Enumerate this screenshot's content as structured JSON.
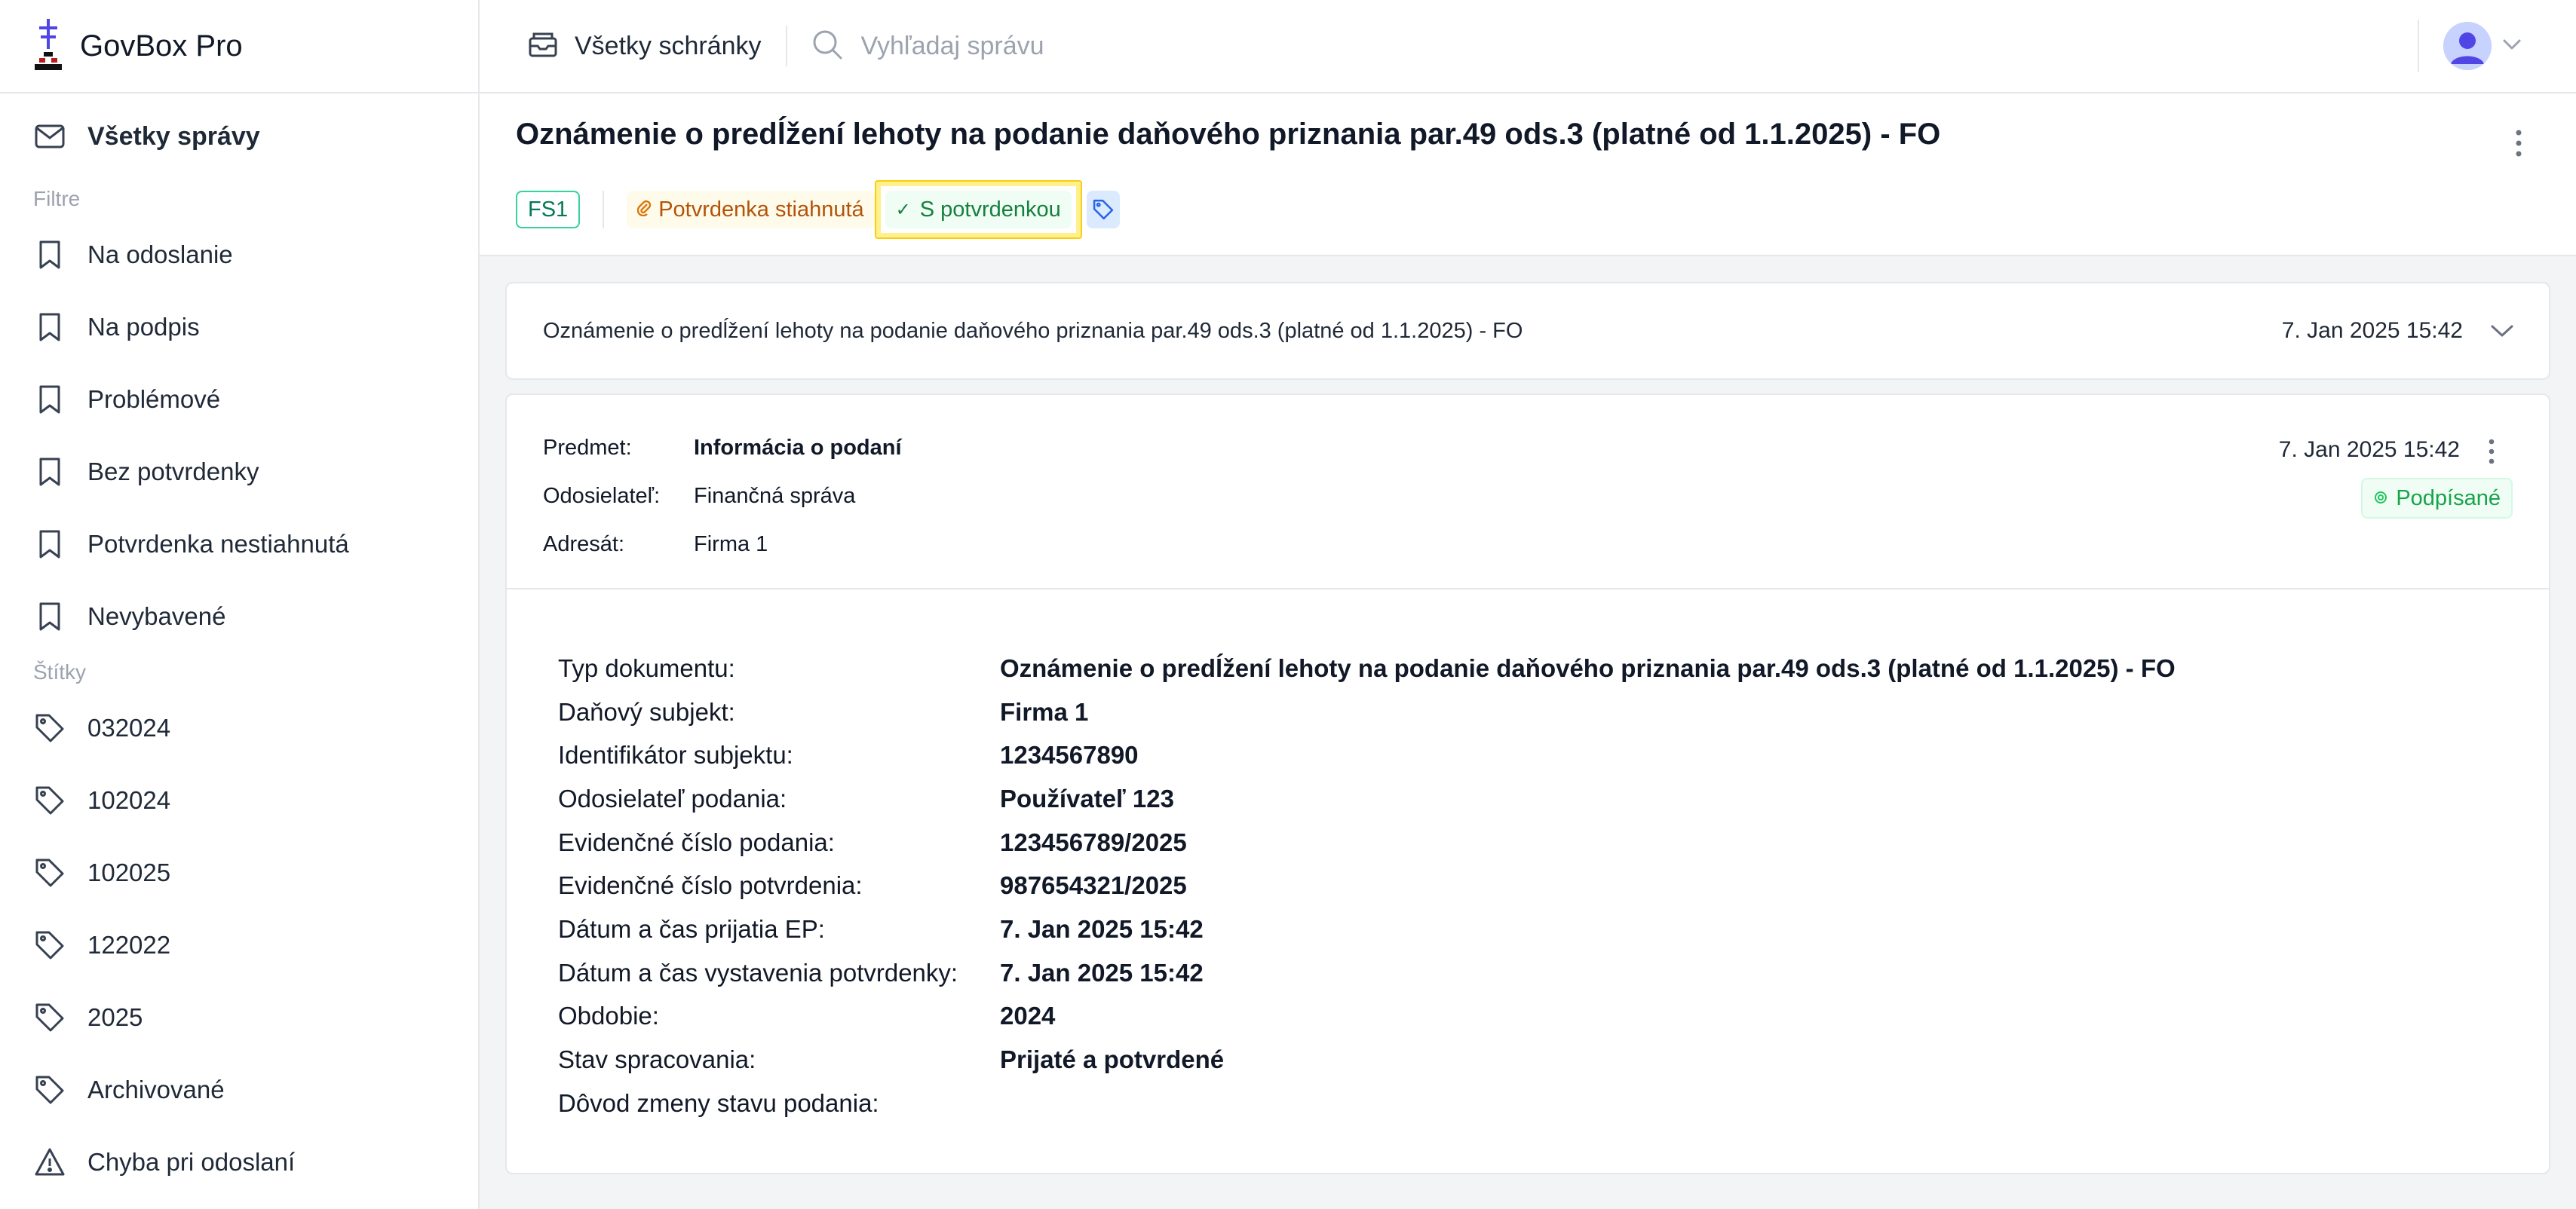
{
  "brand": {
    "name": "GovBox Pro"
  },
  "sidebar": {
    "all_messages": "Všetky správy",
    "filters_title": "Filtre",
    "filters": [
      {
        "label": "Na odoslanie"
      },
      {
        "label": "Na podpis"
      },
      {
        "label": "Problémové"
      },
      {
        "label": "Bez potvrdenky"
      },
      {
        "label": "Potvrdenka nestiahnutá"
      },
      {
        "label": "Nevybavené"
      }
    ],
    "tags_title": "Štítky",
    "tags": [
      {
        "label": "032024"
      },
      {
        "label": "102024"
      },
      {
        "label": "102025"
      },
      {
        "label": "122022"
      },
      {
        "label": "2025"
      },
      {
        "label": "Archivované"
      }
    ],
    "error_item": "Chyba pri odoslaní"
  },
  "topbar": {
    "mailboxes_label": "Všetky schránky",
    "search_placeholder": "Vyhľadaj správu"
  },
  "message": {
    "title": "Oznámenie o predĺžení lehoty na podanie daňového priznania par.49 ods.3 (platné od 1.1.2025) - FO",
    "tags": {
      "box": "FS1",
      "downloaded": "Potvrdenka stiahnutá",
      "with_receipt": "S potvrdenkou"
    }
  },
  "thread_item": {
    "subject": "Oznámenie o predĺžení lehoty na podanie daňového priznania par.49 ods.3 (platné od 1.1.2025) - FO",
    "date": "7. Jan 2025 15:42"
  },
  "detail": {
    "labels": {
      "subject": "Predmet:",
      "sender": "Odosielateľ:",
      "recipient": "Adresát:"
    },
    "subject": "Informácia o podaní",
    "sender": "Finančná správa",
    "recipient": "Firma 1",
    "date": "7. Jan 2025 15:42",
    "signed_badge": "Podpísané",
    "fields": [
      {
        "k": "Typ dokumentu:",
        "v": "Oznámenie o predĺžení lehoty na podanie daňového priznania par.49 ods.3 (platné od 1.1.2025) - FO"
      },
      {
        "k": "Daňový subjekt:",
        "v": "Firma 1"
      },
      {
        "k": "Identifikátor subjektu:",
        "v": "1234567890"
      },
      {
        "k": "Odosielateľ podania:",
        "v": "Používateľ 123"
      },
      {
        "k": "Evidenčné číslo podania:",
        "v": "123456789/2025"
      },
      {
        "k": "Evidenčné číslo potvrdenia:",
        "v": "987654321/2025"
      },
      {
        "k": "Dátum a čas prijatia EP:",
        "v": "7. Jan 2025 15:42"
      },
      {
        "k": "Dátum a čas vystavenia potvrdenky:",
        "v": "7. Jan 2025 15:42"
      },
      {
        "k": "Obdobie:",
        "v": "2024"
      },
      {
        "k": "Stav spracovania:",
        "v": "Prijaté a potvrdené"
      },
      {
        "k": "Dôvod zmeny stavu podania:",
        "v": ""
      }
    ]
  },
  "colors": {
    "accent_blue": "#4f46e5",
    "tag_green": "#15803d",
    "tag_amber": "#b45309",
    "highlight": "#facc15"
  }
}
